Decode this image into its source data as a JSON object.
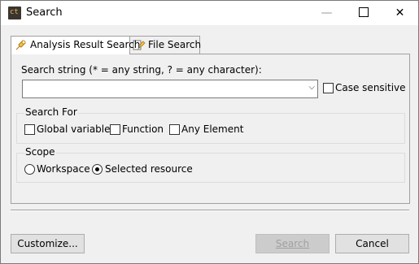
{
  "window": {
    "title": "Search",
    "app_icon_text": "ct",
    "minimize": "—",
    "close": "✕"
  },
  "tabs": [
    {
      "label": "Analysis Result Search",
      "icon": "analysis-search-icon",
      "active": true
    },
    {
      "label": "File Search",
      "icon": "file-search-icon",
      "active": false
    }
  ],
  "search": {
    "string_label": "Search string (* = any string, ? = any character):",
    "value": "",
    "dropdown_glyph": "⌵",
    "case_sensitive_label": "Case sensitive",
    "case_sensitive": false
  },
  "search_for": {
    "legend": "Search For",
    "options": [
      {
        "label": "Global variable",
        "checked": false
      },
      {
        "label": "Function",
        "checked": false
      },
      {
        "label": "Any Element",
        "checked": false
      }
    ]
  },
  "scope": {
    "legend": "Scope",
    "options": [
      {
        "label": "Workspace",
        "selected": false
      },
      {
        "label": "Selected resource",
        "selected": true
      }
    ]
  },
  "buttons": {
    "customize": "Customize...",
    "search": "Search",
    "cancel": "Cancel"
  }
}
